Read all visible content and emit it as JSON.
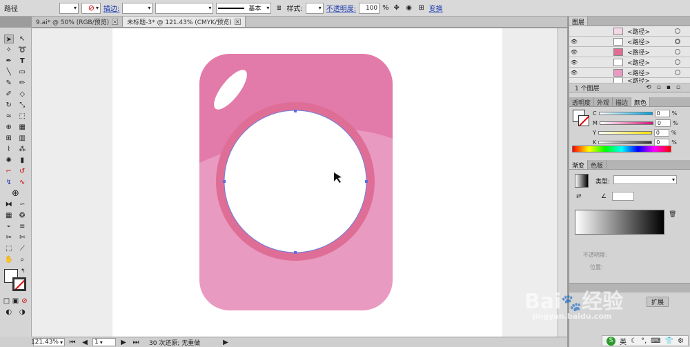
{
  "control_bar": {
    "object_type": "路径",
    "stroke_label": "描边:",
    "stroke_profile": "基本",
    "style_label": "样式:",
    "opacity_label": "不透明度:",
    "opacity_value": "100",
    "percent": "%",
    "transform_label": "变换"
  },
  "doc_tabs": [
    {
      "label": "9.ai* @ 50% (RGB/预览)"
    },
    {
      "label": "未标题-3* @ 121.43% (CMYK/预览)"
    }
  ],
  "layers_panel": {
    "tab": "图层",
    "rows": [
      {
        "name": "<路径>"
      },
      {
        "name": "<路径>"
      },
      {
        "name": "<路径>"
      },
      {
        "name": "<路径>"
      },
      {
        "name": "<路径>"
      },
      {
        "name": "<路径>"
      }
    ],
    "footer": "1 个图层"
  },
  "color_panel": {
    "tabs": [
      "透明度",
      "外观",
      "描边",
      "颜色"
    ],
    "channels": [
      {
        "label": "C",
        "value": "0",
        "color": "#00a3e0"
      },
      {
        "label": "M",
        "value": "0",
        "color": "#d4147a"
      },
      {
        "label": "Y",
        "value": "0",
        "color": "#f4e100"
      },
      {
        "label": "K",
        "value": "0",
        "color": "#333333"
      }
    ],
    "unit": "%"
  },
  "gradient_panel": {
    "tabs": [
      "渐变",
      "色板"
    ],
    "type_label": "类型:",
    "opacity_label": "不透明度:",
    "position_label": "位置:",
    "expand_label": "扩展"
  },
  "status_bar": {
    "zoom": "121.43%",
    "page": "1",
    "message": "30 次还原; 无重做"
  },
  "artwork": {
    "body_top": "#e27aaa",
    "body_bottom": "#e99ac0",
    "lens_ring": "#df6e96",
    "lens": "#ffffff"
  },
  "watermark": {
    "brand": "Bai",
    "suffix": "经验",
    "url": "jingyan.baidu.com"
  },
  "ime": {
    "label": "英"
  }
}
